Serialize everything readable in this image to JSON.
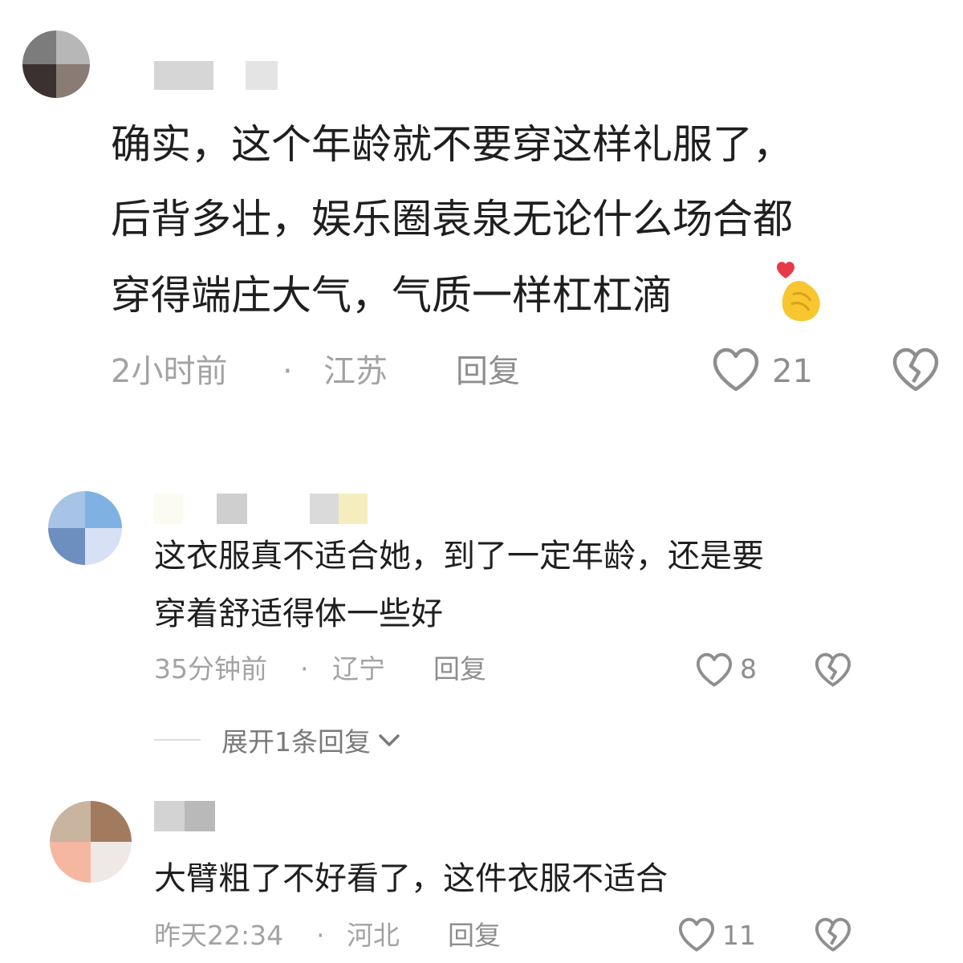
{
  "comments": [
    {
      "text_lines": [
        "确实，这个年龄就不要穿这样礼服了，",
        "后背多壮，娱乐圈袁泉无论什么场合都",
        "穿得端庄大气，气质一样杠杠滴"
      ],
      "emoji": "🫰",
      "time": "2小时前",
      "dot": "·",
      "location": "江苏",
      "reply_label": "回复",
      "likes": "21"
    },
    {
      "text_lines": [
        "这衣服真不适合她，到了一定年龄，还是要",
        "穿着舒适得体一些好"
      ],
      "time": "35分钟前",
      "dot": "·",
      "location": "辽宁",
      "reply_label": "回复",
      "likes": "8",
      "expand_label": "展开1条回复"
    },
    {
      "text_lines": [
        "大臂粗了不好看了，这件衣服不适合"
      ],
      "time": "昨天22:34",
      "dot": "·",
      "location": "河北",
      "reply_label": "回复",
      "likes": "11"
    }
  ],
  "icons": {
    "like": "heart-outline-icon",
    "dislike": "broken-heart-icon",
    "expand": "chevron-down-icon"
  },
  "colors": {
    "text": "#1f1f1f",
    "meta": "#a3a3a3",
    "icon": "#8e8e8e",
    "emoji_heart": "#e8394b",
    "emoji_hand": "#f8c630"
  }
}
